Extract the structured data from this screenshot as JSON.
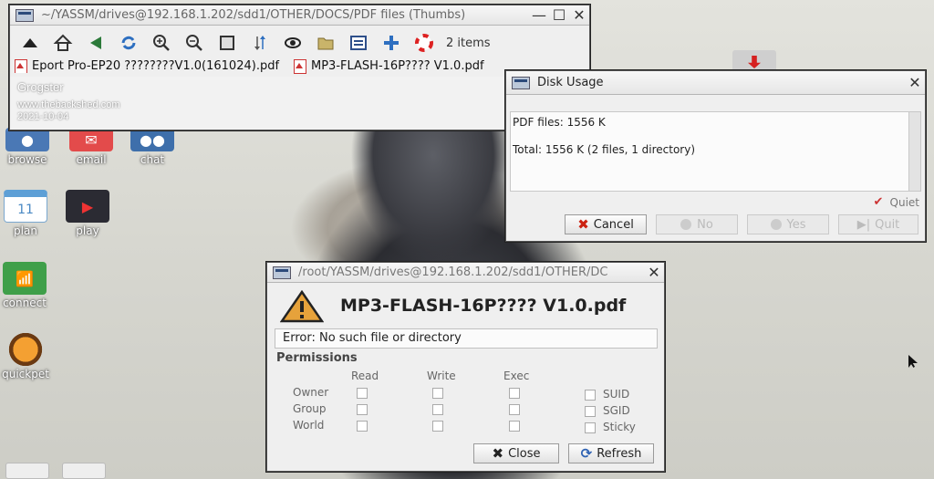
{
  "desktop": {
    "icons": [
      {
        "label": "browse"
      },
      {
        "label": "email"
      },
      {
        "label": "chat"
      },
      {
        "label": "plan",
        "day": "11"
      },
      {
        "label": "play"
      },
      {
        "label": "connect"
      },
      {
        "label": "quickpet"
      }
    ]
  },
  "watermark": {
    "name": "Grogster",
    "site": "www.thebackshed.com",
    "date": "2021-10-04"
  },
  "file_manager": {
    "title": "~/YASSM/drives@192.168.1.202/sdd1/OTHER/DOCS/PDF files (Thumbs)",
    "items_count": "2 items",
    "files": [
      {
        "name": "Eport Pro-EP20 ????????V1.0(161024).pdf"
      },
      {
        "name": "MP3-FLASH-16P???? V1.0.pdf"
      }
    ],
    "toolbar_icons": [
      "up-icon",
      "home-icon",
      "back-icon",
      "refresh-icon",
      "zoom-in-icon",
      "zoom-out-icon",
      "view-icon",
      "sort-icon",
      "eye-icon",
      "folder-icon",
      "list-icon",
      "add-icon",
      "help-icon"
    ]
  },
  "disk_usage": {
    "title": "Disk Usage",
    "line1": "PDF files: 1556 K",
    "line2": "Total: 1556 K (2 files, 1 directory)",
    "quiet_label": "Quiet",
    "cancel_label": "Cancel",
    "no_label": "No",
    "yes_label": "Yes",
    "quit_label": "Quit"
  },
  "error_dialog": {
    "title": "/root/YASSM/drives@192.168.1.202/sdd1/OTHER/DC",
    "heading": "MP3-FLASH-16P???? V1.0.pdf",
    "message": "Error:  No such file or directory",
    "permissions_label": "Permissions",
    "columns": [
      "Read",
      "Write",
      "Exec"
    ],
    "rows": [
      "Owner",
      "Group",
      "World"
    ],
    "flags": [
      "SUID",
      "SGID",
      "Sticky"
    ],
    "close_label": "Close",
    "refresh_label": "Refresh"
  }
}
